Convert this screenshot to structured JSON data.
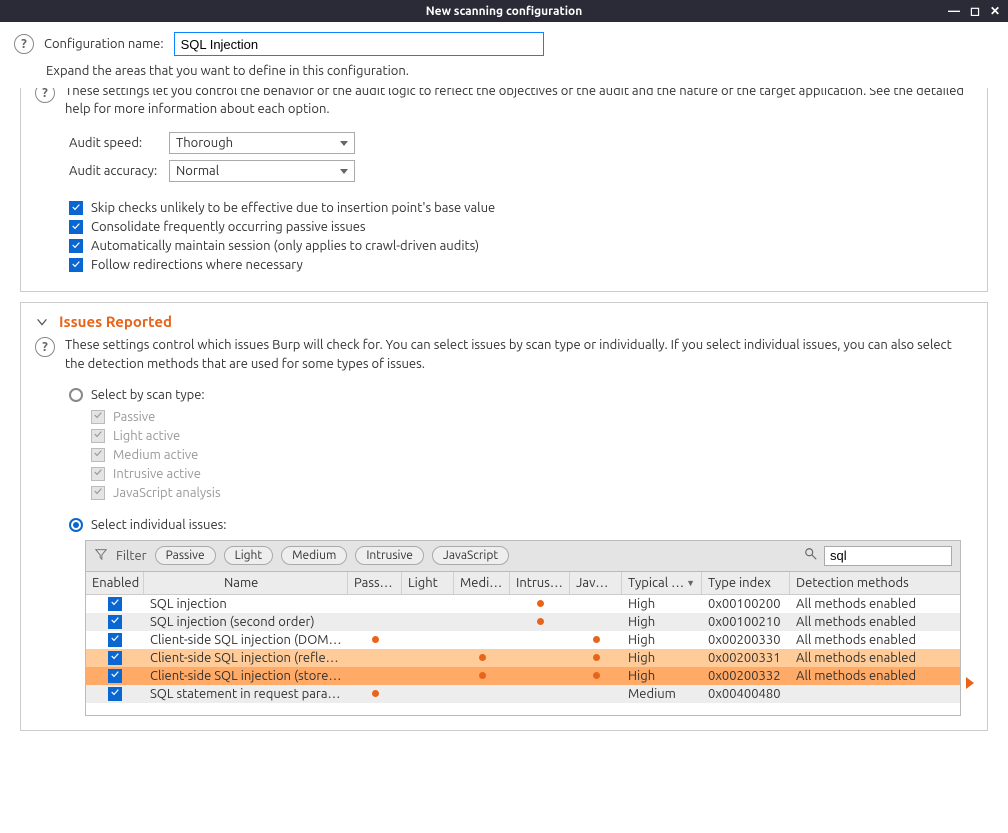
{
  "window": {
    "title": "New scanning configuration"
  },
  "header": {
    "config_name_label": "Configuration name:",
    "config_name_value": "SQL Injection",
    "expand_hint": "Expand the areas that you want to define in this configuration."
  },
  "audit_panel": {
    "desc": "These settings let you control the behavior of the audit logic to reflect the objectives of the audit and the nature of the target application. See the detailed help for more information about each option.",
    "speed_label": "Audit speed:",
    "speed_value": "Thorough",
    "accuracy_label": "Audit accuracy:",
    "accuracy_value": "Normal",
    "checks": {
      "skip": "Skip checks unlikely to be effective due to insertion point's base value",
      "consolidate": "Consolidate frequently occurring passive issues",
      "maintain_session": "Automatically maintain session (only applies to crawl-driven audits)",
      "follow_redirects": "Follow redirections where necessary"
    }
  },
  "issues_panel": {
    "title": "Issues Reported",
    "desc": "These settings control which issues Burp will check for. You can select issues by scan type or individually. If you select individual issues, you can also select the detection methods that are used for some types of issues.",
    "radio_scantype": "Select by scan type:",
    "scantypes": {
      "passive": "Passive",
      "light": "Light active",
      "medium": "Medium active",
      "intrusive": "Intrusive active",
      "javascript": "JavaScript analysis"
    },
    "radio_individual": "Select individual issues:",
    "filter_label": "Filter",
    "pills": {
      "passive": "Passive",
      "light": "Light",
      "medium": "Medium",
      "intrusive": "Intrusive",
      "javascript": "JavaScript"
    },
    "search_value": "sql",
    "columns": {
      "enabled": "Enabled",
      "name": "Name",
      "passive": "Passive",
      "light": "Light",
      "medium": "Medium",
      "intrusive": "Intrusive",
      "javas": "JavaS…",
      "typical": "Typical …",
      "typeindex": "Type index",
      "detection": "Detection methods"
    },
    "rows": [
      {
        "name": "SQL injection",
        "passive": false,
        "light": false,
        "medium": false,
        "intrusive": true,
        "javascript": false,
        "severity": "High",
        "typeindex": "0x00100200",
        "detection": "All methods enabled",
        "alt": false
      },
      {
        "name": "SQL injection (second order)",
        "passive": false,
        "light": false,
        "medium": false,
        "intrusive": true,
        "javascript": false,
        "severity": "High",
        "typeindex": "0x00100210",
        "detection": "All methods enabled",
        "alt": true
      },
      {
        "name": "Client-side SQL injection (DOM-…",
        "passive": true,
        "light": false,
        "medium": false,
        "intrusive": false,
        "javascript": true,
        "severity": "High",
        "typeindex": "0x00200330",
        "detection": "All methods enabled",
        "alt": false
      },
      {
        "name": "Client-side SQL injection (reflect…",
        "passive": false,
        "light": false,
        "medium": true,
        "intrusive": false,
        "javascript": true,
        "severity": "High",
        "typeindex": "0x00200331",
        "detection": "All methods enabled",
        "highlight": true
      },
      {
        "name": "Client-side SQL injection (stored …",
        "passive": false,
        "light": false,
        "medium": true,
        "intrusive": false,
        "javascript": true,
        "severity": "High",
        "typeindex": "0x00200332",
        "detection": "All methods enabled",
        "select": true
      },
      {
        "name": "SQL statement in request param…",
        "passive": true,
        "light": false,
        "medium": false,
        "intrusive": false,
        "javascript": false,
        "severity": "Medium",
        "typeindex": "0x00400480",
        "detection": "",
        "alt": true
      }
    ]
  }
}
